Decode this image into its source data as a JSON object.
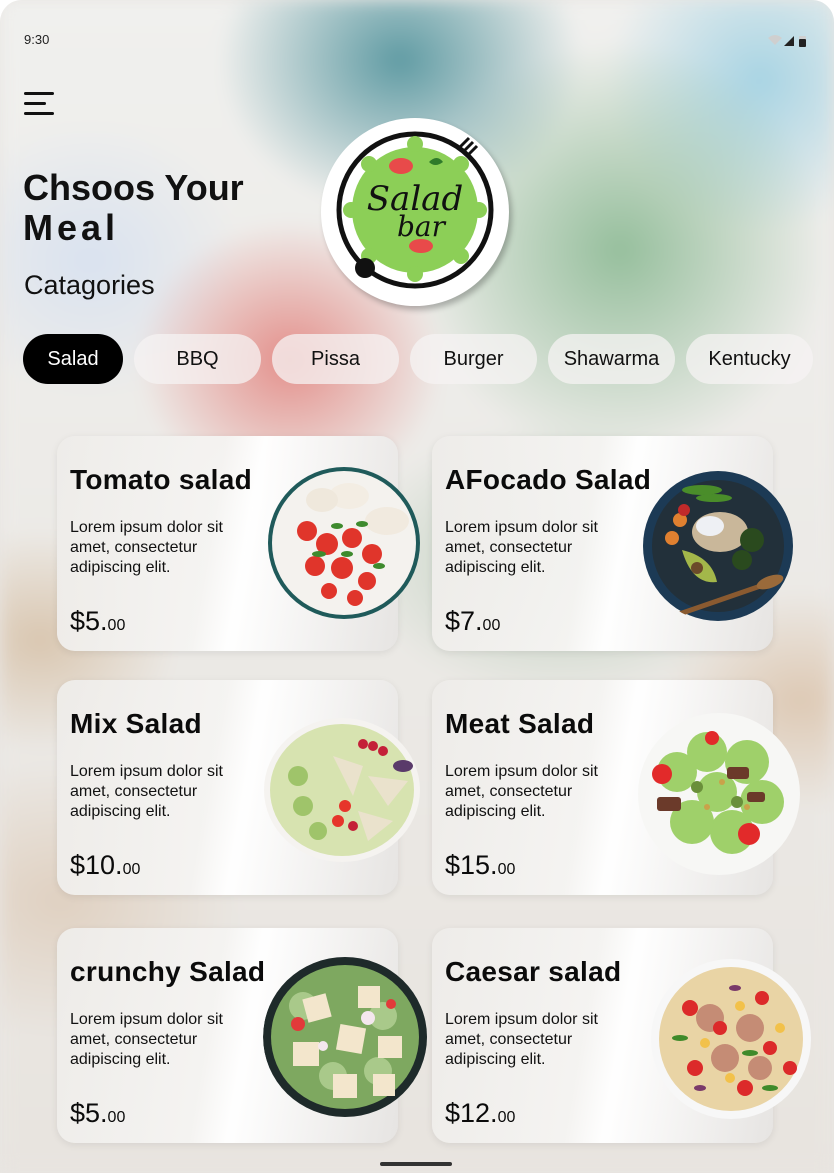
{
  "status": {
    "time": "9:30"
  },
  "header": {
    "title_line1": "Chsoos Your",
    "title_line2": "Meal",
    "categories_label": "Catagories"
  },
  "logo": {
    "line1": "Salad",
    "line2": "bar"
  },
  "categories": [
    {
      "label": "Salad",
      "active": true
    },
    {
      "label": "BBQ"
    },
    {
      "label": "Pissa"
    },
    {
      "label": "Burger"
    },
    {
      "label": "Shawarma"
    },
    {
      "label": "Kentucky"
    }
  ],
  "items": [
    {
      "name": "Tomato salad",
      "desc": "Lorem ipsum dolor sit amet, consectetur adipiscing elit.",
      "price_main": "$5.",
      "price_cents": "00"
    },
    {
      "name": "AFocado Salad",
      "desc": "Lorem ipsum dolor sit amet, consectetur adipiscing elit.",
      "price_main": "$7.",
      "price_cents": "00"
    },
    {
      "name": "Mix Salad",
      "desc": "Lorem ipsum dolor sit amet, consectetur adipiscing elit.",
      "price_main": "$10.",
      "price_cents": "00"
    },
    {
      "name": "Meat Salad",
      "desc": "Lorem ipsum dolor sit amet, consectetur adipiscing elit.",
      "price_main": "$15.",
      "price_cents": "00"
    },
    {
      "name": "crunchy Salad",
      "desc": "Lorem ipsum dolor sit amet, consectetur adipiscing elit.",
      "price_main": "$5.",
      "price_cents": "00"
    },
    {
      "name": "Caesar salad",
      "desc": "Lorem ipsum dolor sit amet, consectetur adipiscing elit.",
      "price_main": "$12.",
      "price_cents": "00"
    }
  ]
}
